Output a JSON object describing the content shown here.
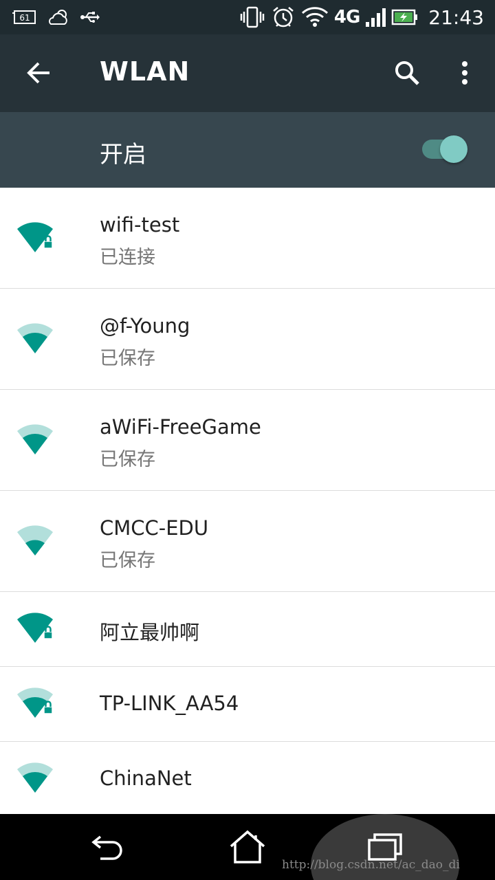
{
  "status_bar": {
    "notification_badge": "61",
    "clock": "21:43",
    "network_type": "4G"
  },
  "app_bar": {
    "title": "WLAN"
  },
  "switch": {
    "label": "开启",
    "state": "on"
  },
  "networks": [
    {
      "name": "wifi-test",
      "status": "已连接",
      "locked": true
    },
    {
      "name": "@f-Young",
      "status": "已保存",
      "locked": false
    },
    {
      "name": "aWiFi-FreeGame",
      "status": "已保存",
      "locked": false
    },
    {
      "name": "CMCC-EDU",
      "status": "已保存",
      "locked": false
    },
    {
      "name": "阿立最帅啊",
      "status": "",
      "locked": true
    },
    {
      "name": "TP-LINK_AA54",
      "status": "",
      "locked": true
    },
    {
      "name": "ChinaNet",
      "status": "",
      "locked": false
    }
  ],
  "watermark": "http://blog.csdn.net/ac_dao_di",
  "colors": {
    "status_bar": "#1f2b30",
    "app_bar": "#263238",
    "switch_bar": "#37474f",
    "accent": "#009688",
    "toggle_thumb": "#80cbc4"
  }
}
